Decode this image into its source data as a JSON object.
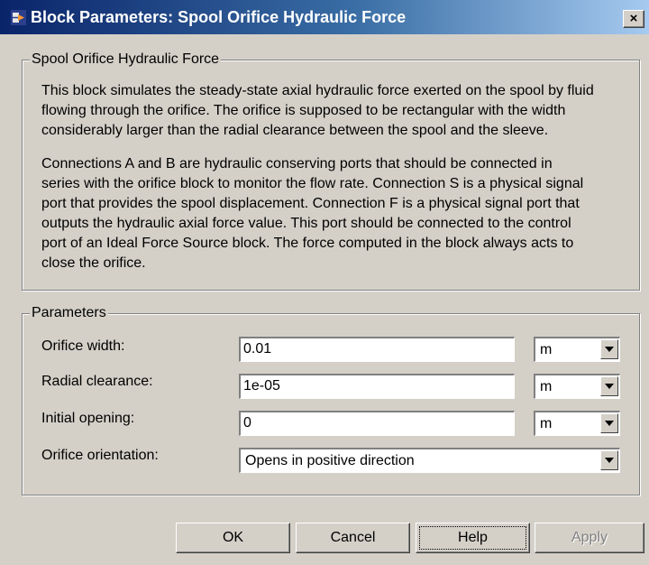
{
  "window": {
    "title": "Block Parameters: Spool Orifice Hydraulic Force",
    "close_label": "×"
  },
  "description": {
    "legend": "Spool Orifice Hydraulic Force",
    "paragraph1": [
      "This block simulates the steady-state axial hydraulic force exerted on the spool by fluid",
      "flowing through the orifice. The orifice is supposed to be rectangular with the width",
      "considerably larger than the radial clearance between the spool and the sleeve."
    ],
    "paragraph2": [
      "Connections A and B are hydraulic conserving ports that should be connected in",
      "series with the orifice block to monitor the flow rate. Connection S is a physical signal",
      "port that provides the spool displacement. Connection F is a physical signal port that",
      "outputs the hydraulic axial force value. This port should be connected to the control",
      "port of an Ideal Force Source block. The force computed in the block always acts to",
      "close the orifice."
    ]
  },
  "parameters": {
    "legend": "Parameters",
    "orifice_width": {
      "label": "Orifice width:",
      "value": "0.01",
      "unit": "m"
    },
    "radial_clearance": {
      "label": "Radial clearance:",
      "value": "1e-05",
      "unit": "m"
    },
    "initial_opening": {
      "label": "Initial opening:",
      "value": "0",
      "unit": "m"
    },
    "orifice_orientation": {
      "label": "Orifice orientation:",
      "value": "Opens in positive direction"
    }
  },
  "buttons": {
    "ok": "OK",
    "cancel": "Cancel",
    "help": "Help",
    "apply": "Apply"
  },
  "colors": {
    "dialog_bg": "#d4d0c8",
    "title_gradient_start": "#0a246a",
    "title_gradient_end": "#a6caf0",
    "disabled_text": "#808080"
  },
  "icons": {
    "title": "simulink-block-icon",
    "dropdown": "chevron-down-icon"
  }
}
